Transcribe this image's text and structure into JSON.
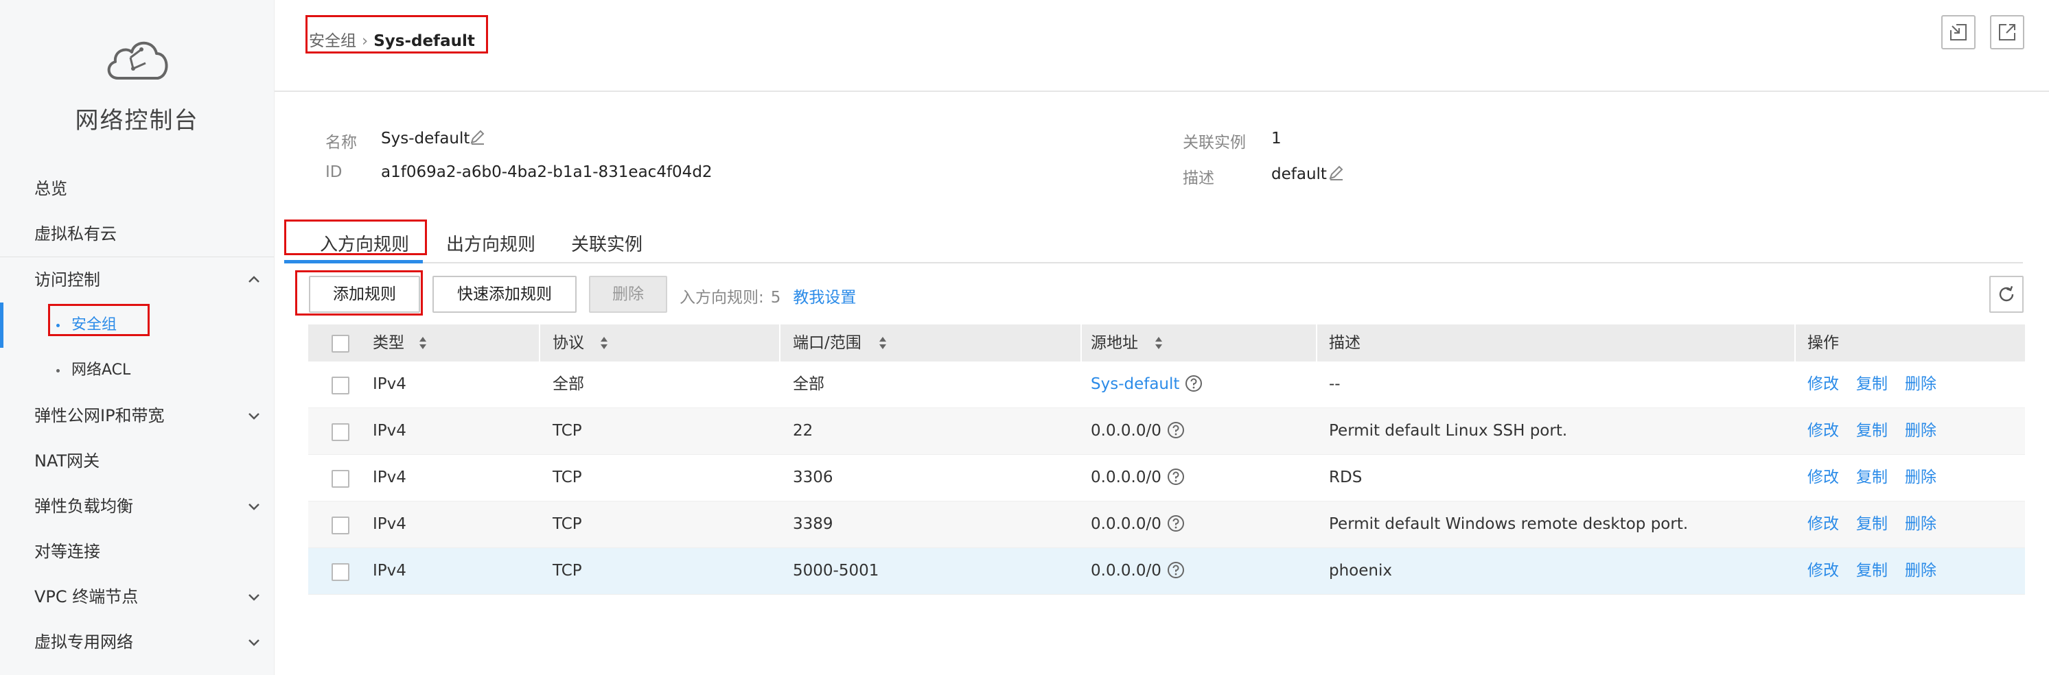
{
  "sidebar": {
    "console_title": "网络控制台",
    "items": [
      {
        "label": "总览"
      },
      {
        "label": "虚拟私有云"
      },
      {
        "label": "访问控制"
      },
      {
        "label": "安全组"
      },
      {
        "label": "网络ACL"
      },
      {
        "label": "弹性公网IP和带宽"
      },
      {
        "label": "NAT网关"
      },
      {
        "label": "弹性负载均衡"
      },
      {
        "label": "对等连接"
      },
      {
        "label": "VPC 终端节点"
      },
      {
        "label": "虚拟专用网络"
      }
    ]
  },
  "header": {
    "breadcrumb_parent": "安全组",
    "breadcrumb_current": "Sys-default"
  },
  "info": {
    "name_label": "名称",
    "name_value": "Sys-default",
    "id_label": "ID",
    "id_value": "a1f069a2-a6b0-4ba2-b1a1-831eac4f04d2",
    "instances_label": "关联实例",
    "instances_value": "1",
    "desc_label": "描述",
    "desc_value": "default"
  },
  "tabs": [
    "入方向规则",
    "出方向规则",
    "关联实例"
  ],
  "toolbar": {
    "add_rule": "添加规则",
    "quick_add_rule": "快速添加规则",
    "delete": "删除",
    "rule_count_label": "入方向规则:",
    "rule_count": "5",
    "teach_link": "教我设置"
  },
  "table": {
    "headers": {
      "type": "类型",
      "protocol": "协议",
      "port": "端口/范围",
      "source": "源地址",
      "desc": "描述",
      "ops": "操作"
    },
    "rows": [
      {
        "type": "IPv4",
        "protocol": "全部",
        "port": "全部",
        "source": "Sys-default",
        "desc": "--"
      },
      {
        "type": "IPv4",
        "protocol": "TCP",
        "port": "22",
        "source": "0.0.0.0/0",
        "desc": "Permit default Linux SSH port."
      },
      {
        "type": "IPv4",
        "protocol": "TCP",
        "port": "3306",
        "source": "0.0.0.0/0",
        "desc": "RDS"
      },
      {
        "type": "IPv4",
        "protocol": "TCP",
        "port": "3389",
        "source": "0.0.0.0/0",
        "desc": "Permit default Windows remote desktop port."
      },
      {
        "type": "IPv4",
        "protocol": "TCP",
        "port": "5000-5001",
        "source": "0.0.0.0/0",
        "desc": "phoenix"
      }
    ],
    "ops": {
      "modify": "修改",
      "copy": "复制",
      "delete": "删除"
    }
  },
  "colors": {
    "accent": "#2b8be8",
    "highlight": "#e01010"
  }
}
